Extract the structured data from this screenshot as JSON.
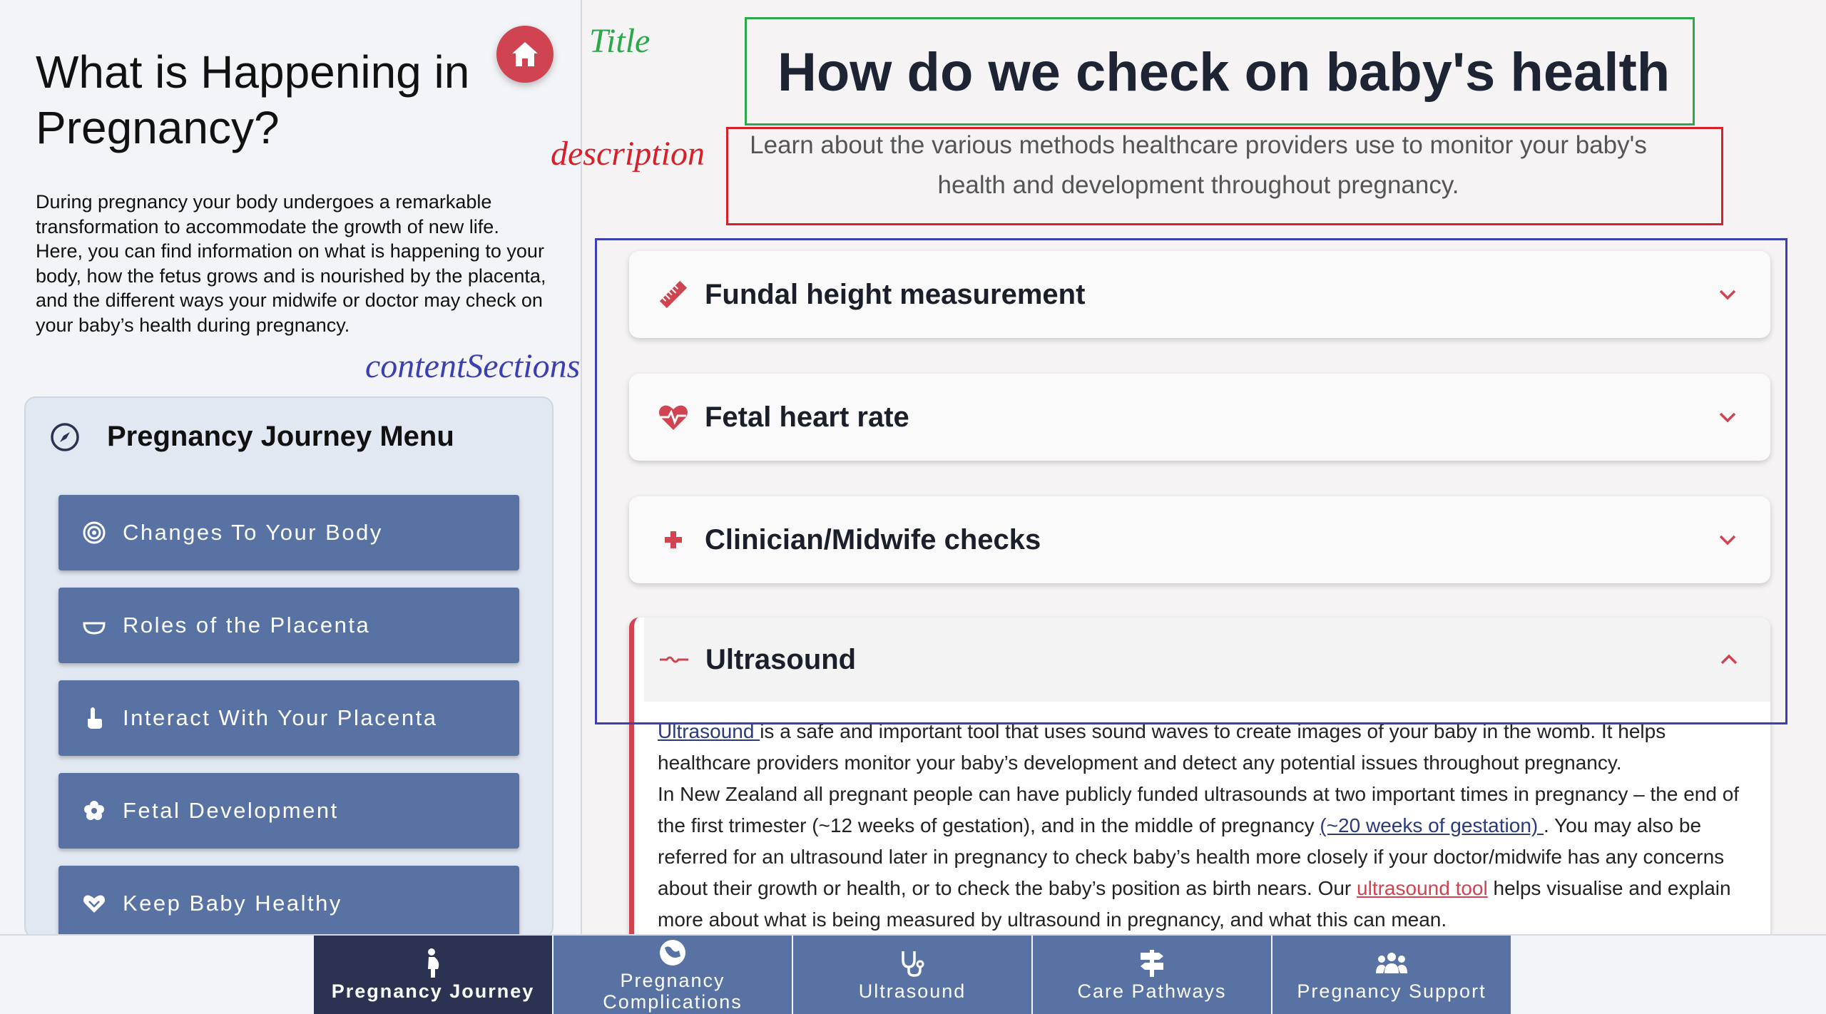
{
  "left": {
    "title": "What is Happening in Pregnancy?",
    "intro": "During pregnancy your body undergoes a remarkable transformation to accommodate the growth of new life. Here, you can find information on what is happening to your body, how the fetus grows and is nourished by the placenta, and the different ways your midwife or doctor may check on your baby’s health during pregnancy.",
    "home_icon": "home-icon",
    "menu": {
      "title": "Pregnancy Journey Menu",
      "icon": "compass-icon",
      "items": [
        {
          "label": "Changes To Your Body",
          "icon": "target-icon"
        },
        {
          "label": "Roles of the Placenta",
          "icon": "bowl-icon"
        },
        {
          "label": "Interact With Your Placenta",
          "icon": "hand-pointer-icon"
        },
        {
          "label": "Fetal Development",
          "icon": "flower-icon"
        },
        {
          "label": "Keep Baby Healthy",
          "icon": "hand-heart-icon"
        }
      ]
    }
  },
  "annotations": {
    "title": "Title",
    "description": "description",
    "content_sections": "contentSections",
    "colors": {
      "title": "#2aa84a",
      "description": "#d6202a",
      "content_sections": "#3b3fb0"
    }
  },
  "main": {
    "title": "How do we check on baby's health",
    "description": "Learn about the various methods healthcare providers use to monitor your baby's health and development throughout pregnancy.",
    "sections": [
      {
        "label": "Fundal height measurement",
        "icon": "ruler-icon"
      },
      {
        "label": "Fetal heart rate",
        "icon": "heartbeat-icon"
      },
      {
        "label": "Clinician/Midwife checks",
        "icon": "plus-icon"
      },
      {
        "label": "Ultrasound",
        "icon": "wave-icon"
      }
    ],
    "ultrasound_body": {
      "link1": "Ultrasound ",
      "p1_rest": "is a safe and important tool that uses sound waves to create images of your baby in the womb. It helps healthcare providers monitor your baby’s development and detect any potential issues throughout pregnancy.",
      "p2_start": "In New Zealand all pregnant people can have publicly funded ultrasounds at two important times in pregnancy – the end of the first trimester (~12 weeks of gestation), and in the middle of pregnancy ",
      "link2": "(~20 weeks of gestation) ",
      "p2_mid": ". You may also be referred for an ultrasound later in pregnancy to check baby’s health more closely if your doctor/midwife has any concerns about their growth or health, or to check the baby’s position as birth nears. Our ",
      "link3": "ultrasound tool",
      "p2_end": " helps visualise and explain more about what is being measured by ultrasound in pregnancy, and what this can mean."
    }
  },
  "bottom_nav": [
    {
      "label": "Pregnancy Journey",
      "icon": "pregnant-person-icon",
      "active": true
    },
    {
      "label": "Pregnancy Complications",
      "icon": "globe-icon",
      "active": false
    },
    {
      "label": "Ultrasound",
      "icon": "stethoscope-icon",
      "active": false
    },
    {
      "label": "Care Pathways",
      "icon": "signpost-icon",
      "active": false
    },
    {
      "label": "Pregnancy Support",
      "icon": "people-icon",
      "active": false
    }
  ]
}
